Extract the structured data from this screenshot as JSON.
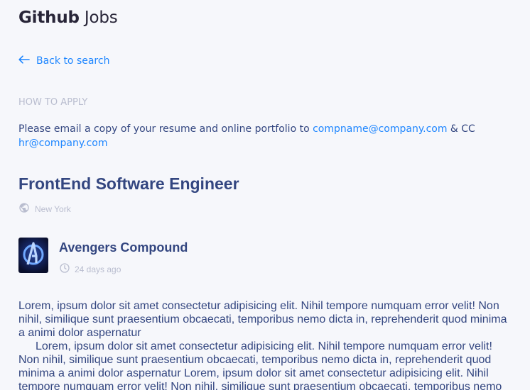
{
  "header": {
    "brand_bold": "Github",
    "brand_light": "Jobs"
  },
  "nav": {
    "back_label": "Back to search",
    "back_icon": "arrow-left-icon"
  },
  "how_to_apply": {
    "label": "How to apply",
    "text_before": "Please email a copy of your resume and online portfolio to ",
    "email_primary": "compname@company.com",
    "text_middle": " & CC ",
    "email_cc": "hr@company.com"
  },
  "job": {
    "title": "FrontEnd Software Engineer",
    "location": "New York",
    "location_icon": "globe-icon",
    "company": "Avengers Compound",
    "posted": "24 days ago",
    "posted_icon": "clock-icon",
    "logo_icon": "avengers-logo-icon",
    "description": [
      "Lorem, ipsum dolor sit amet consectetur adipisicing elit. Nihil tempore numquam error velit! Non nihil, similique sunt praesentium obcaecati, temporibus nemo dicta in, reprehenderit quod minima a animi dolor aspernatur",
      "Lorem, ipsum dolor sit amet consectetur adipisicing elit. Nihil tempore numquam error velit! Non nihil, similique sunt praesentium obcaecati, temporibus nemo dicta in, reprehenderit quod minima a animi dolor aspernatur Lorem, ipsum dolor sit amet consectetur adipisicing elit. Nihil tempore numquam error velit! Non nihil, similique sunt praesentium obcaecati, temporibus nemo"
    ]
  },
  "colors": {
    "accent": "#1e86ff",
    "text": "#334680",
    "muted": "#b9bdcf",
    "background": "#f6f7fb"
  }
}
